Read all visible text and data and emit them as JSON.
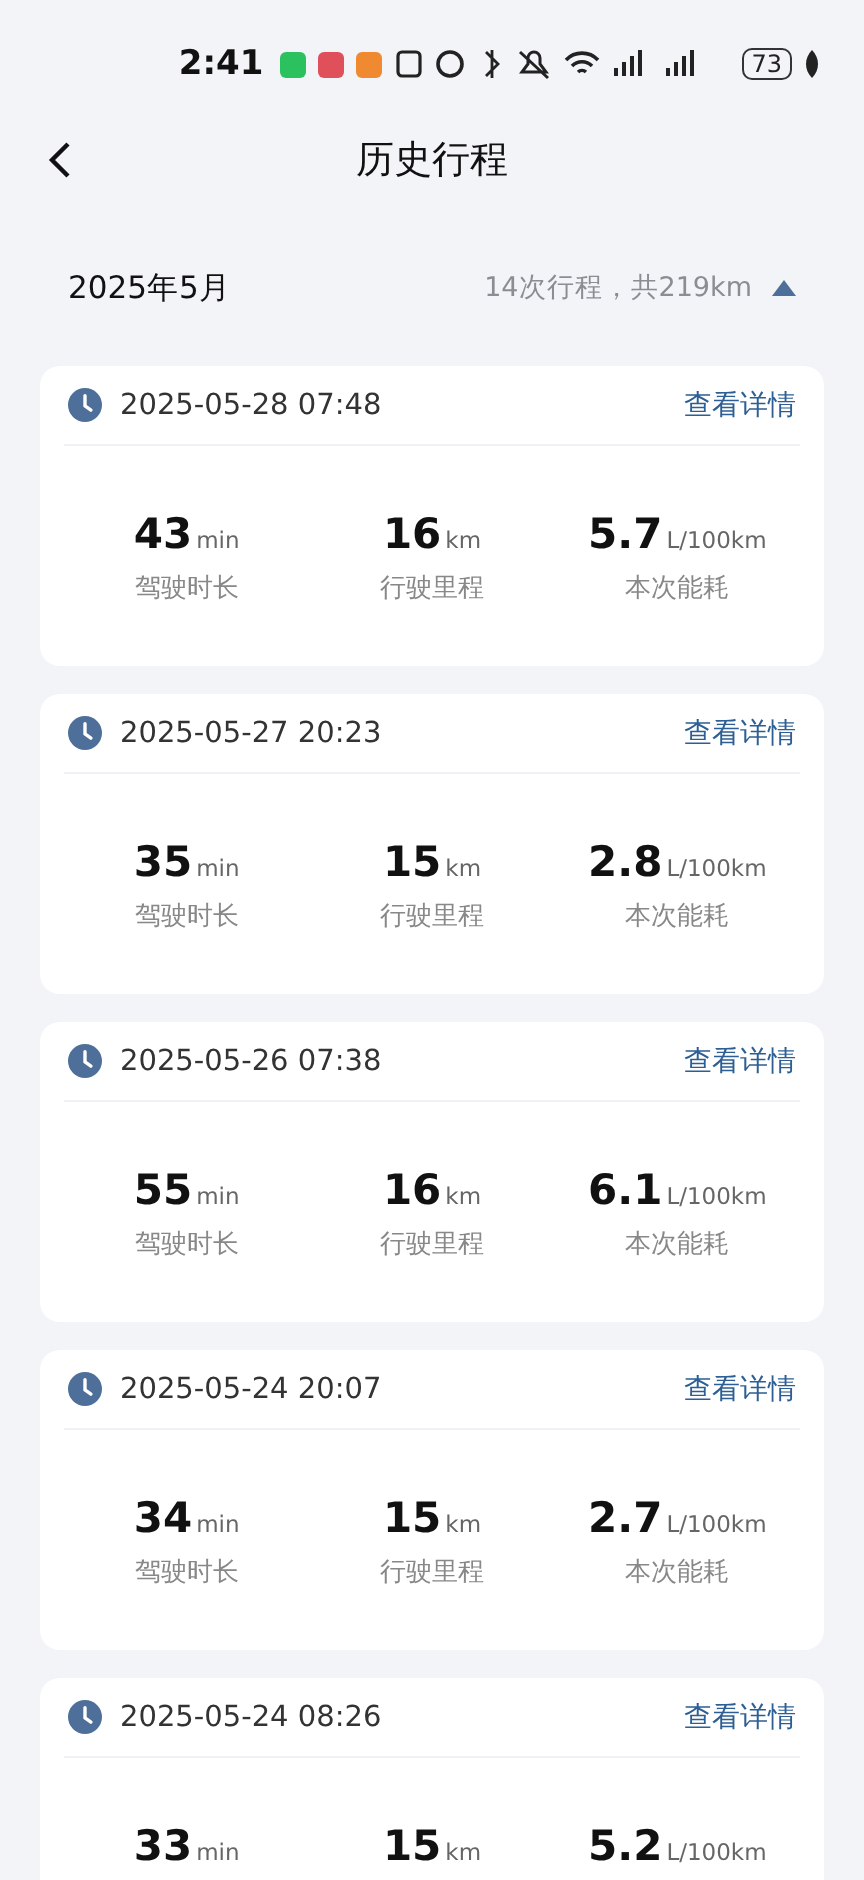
{
  "status_bar": {
    "time": "2:41",
    "battery": "73"
  },
  "header": {
    "title": "历史行程"
  },
  "summary": {
    "month": "2025年5月",
    "totals": "14次行程，共219km",
    "expanded": true
  },
  "trips": [
    {
      "datetime": "2025-05-28 07:48",
      "action": "查看详情",
      "stats": [
        {
          "value": "43",
          "unit": "min",
          "label": "驾驶时长"
        },
        {
          "value": "16",
          "unit": "km",
          "label": "行驶里程"
        },
        {
          "value": "5.7",
          "unit": "L/100km",
          "label": "本次能耗"
        }
      ]
    },
    {
      "datetime": "2025-05-27 20:23",
      "action": "查看详情",
      "stats": [
        {
          "value": "35",
          "unit": "min",
          "label": "驾驶时长"
        },
        {
          "value": "15",
          "unit": "km",
          "label": "行驶里程"
        },
        {
          "value": "2.8",
          "unit": "L/100km",
          "label": "本次能耗"
        }
      ]
    },
    {
      "datetime": "2025-05-26 07:38",
      "action": "查看详情",
      "stats": [
        {
          "value": "55",
          "unit": "min",
          "label": "驾驶时长"
        },
        {
          "value": "16",
          "unit": "km",
          "label": "行驶里程"
        },
        {
          "value": "6.1",
          "unit": "L/100km",
          "label": "本次能耗"
        }
      ]
    },
    {
      "datetime": "2025-05-24 20:07",
      "action": "查看详情",
      "stats": [
        {
          "value": "34",
          "unit": "min",
          "label": "驾驶时长"
        },
        {
          "value": "15",
          "unit": "km",
          "label": "行驶里程"
        },
        {
          "value": "2.7",
          "unit": "L/100km",
          "label": "本次能耗"
        }
      ]
    },
    {
      "datetime": "2025-05-24 08:26",
      "action": "查看详情",
      "stats": [
        {
          "value": "33",
          "unit": "min"
        },
        {
          "value": "15",
          "unit": "km"
        },
        {
          "value": "5.2",
          "unit": "L/100km"
        }
      ]
    }
  ]
}
